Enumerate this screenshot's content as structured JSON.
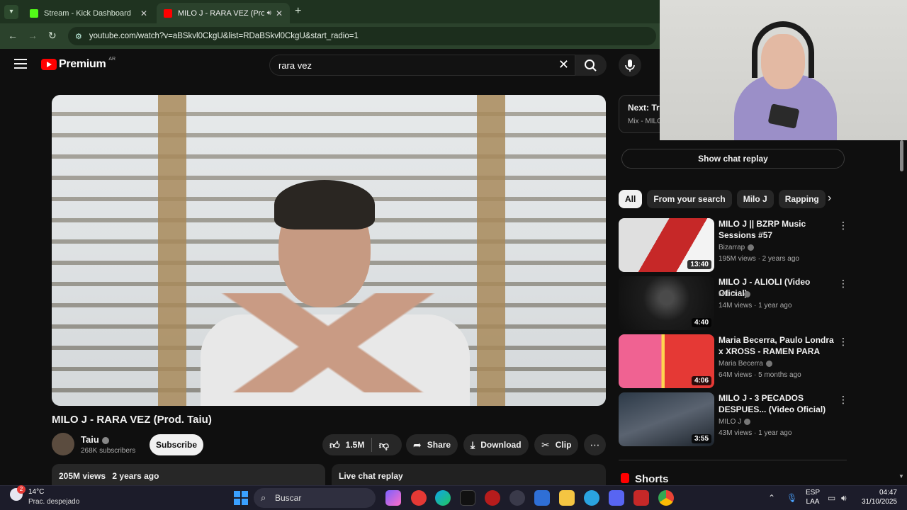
{
  "browser": {
    "tabs": [
      {
        "title": "Stream - Kick Dashboard",
        "favicon_color": "#53fc18"
      },
      {
        "title": "MILO J - RARA VEZ (Prod. T",
        "favicon_color": "#ff0000",
        "active": true
      }
    ],
    "url": "youtube.com/watch?v=aBSkvl0CkgU&list=RDaBSkvl0CkgU&start_radio=1"
  },
  "masthead": {
    "logo_text": "Premium",
    "country_code": "AR",
    "search_value": "rara vez"
  },
  "video": {
    "title": "MILO J - RARA VEZ (Prod. Taiu)",
    "channel": "Taiu",
    "subscribers": "268K subscribers",
    "subscribe_label": "Subscribe",
    "likes": "1.5M",
    "share_label": "Share",
    "download_label": "Download",
    "clip_label": "Clip",
    "views": "205M views",
    "age": "2 years ago",
    "live_chat_label": "Live chat replay"
  },
  "next": {
    "label": "Next: Tru",
    "mix": "Mix - MILO"
  },
  "show_chat_replay": "Show chat replay",
  "chips": [
    "All",
    "From your search",
    "Milo J",
    "Rapping"
  ],
  "recommendations": [
    {
      "title": "MILO J || BZRP Music Sessions #57",
      "channel": "Bizarrap",
      "meta": "195M views · 2 years ago",
      "duration": "13:40"
    },
    {
      "title": "MILO J - ALIOLI (Video Oficial)",
      "channel": "MILO J",
      "meta": "14M views · 1 year ago",
      "duration": "4:40"
    },
    {
      "title": "Maria Becerra, Paulo Londra x XROSS - RAMEN PARA DOS ...",
      "channel": "Maria Becerra",
      "meta": "64M views · 5 months ago",
      "duration": "4:06"
    },
    {
      "title": "MILO J - 3 PECADOS DESPUES... (Video Oficial)",
      "channel": "MILO J",
      "meta": "43M views · 1 year ago",
      "duration": "3:55"
    }
  ],
  "shorts_label": "Shorts",
  "taskbar": {
    "temperature": "14°C",
    "condition": "Prac. despejado",
    "search_placeholder": "Buscar",
    "lang_line1": "ESP",
    "lang_line2": "LAA",
    "time": "04:47",
    "date": "31/10/2025"
  }
}
